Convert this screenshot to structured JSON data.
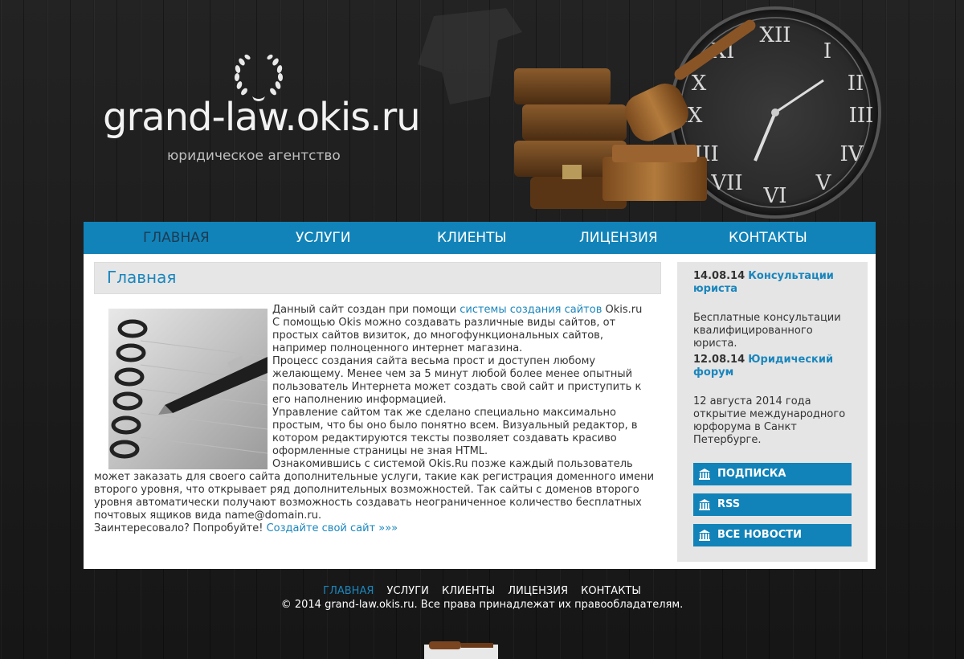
{
  "header": {
    "logo_text": "grand-law.okis.ru",
    "subtitle": "юридическое агентство",
    "logo_icon": "laurel-wreath-icon"
  },
  "nav": {
    "items": [
      {
        "label": "Главная",
        "active": true
      },
      {
        "label": "Услуги",
        "active": false
      },
      {
        "label": "Клиенты",
        "active": false
      },
      {
        "label": "Лицензия",
        "active": false
      },
      {
        "label": "Контакты",
        "active": false
      }
    ]
  },
  "main": {
    "title": "Главная",
    "p1_pre": "Данный сайт создан при помощи ",
    "p1_link": "системы создания сайтов",
    "p1_post": " Okis.ru",
    "p2": "С помощью Okis можно создавать различные виды сайтов, от простых сайтов визиток, до многофункциональных сайтов, например полноценного интернет магазина.",
    "p3": "Процесс создания сайта весьма прост и доступен любому желающему. Менее чем за 5 минут любой более менее опытный пользователь Интернета может создать свой сайт и приступить к его наполнению информацией.",
    "p4": "Управление сайтом так же сделано специально максимально простым, что бы оно было понятно всем. Визуальный редактор, в котором редактируются тексты позволяет создавать красиво оформленные страницы не зная HTML.",
    "p5": "Ознакомившись с системой Okis.Ru позже каждый пользователь может заказать для своего сайта дополнительные услуги, такие как регистрация доменного имени второго уровня, что открывает ряд дополнительных возможностей. Так сайты с доменов второго уровня автоматически получают возможность создавать неограниченное количество бесплатных почтовых ящиков вида name@domain.ru.",
    "p6_pre": "Заинтересовало? Попробуйте! ",
    "p6_link": "Создайте свой сайт »»»"
  },
  "sidebar": {
    "news": [
      {
        "date": "14.08.14",
        "title": "Консультации юриста",
        "text": "Бесплатные консультации квалифицированного юриста."
      },
      {
        "date": "12.08.14",
        "title": "Юридический форум",
        "text": "12 августа 2014 года открытие международного юрфорума в Санкт Петербурге."
      }
    ],
    "buttons": [
      {
        "label": "ПОДПИСКА",
        "icon": "building-icon"
      },
      {
        "label": "RSS",
        "icon": "building-icon"
      },
      {
        "label": "ВСЕ НОВОСТИ",
        "icon": "building-icon"
      }
    ]
  },
  "footer": {
    "nav": [
      {
        "label": "Главная",
        "active": true
      },
      {
        "label": "Услуги",
        "active": false
      },
      {
        "label": "Клиенты",
        "active": false
      },
      {
        "label": "Лицензия",
        "active": false
      },
      {
        "label": "Контакты",
        "active": false
      }
    ],
    "copyright": "© 2014 grand-law.okis.ru. Все права принадлежат их правообладателям."
  },
  "colors": {
    "accent": "#1183b9",
    "link": "#1a86bd",
    "nav_active_text": "#1d3b52",
    "background": "#1b1b1b"
  }
}
